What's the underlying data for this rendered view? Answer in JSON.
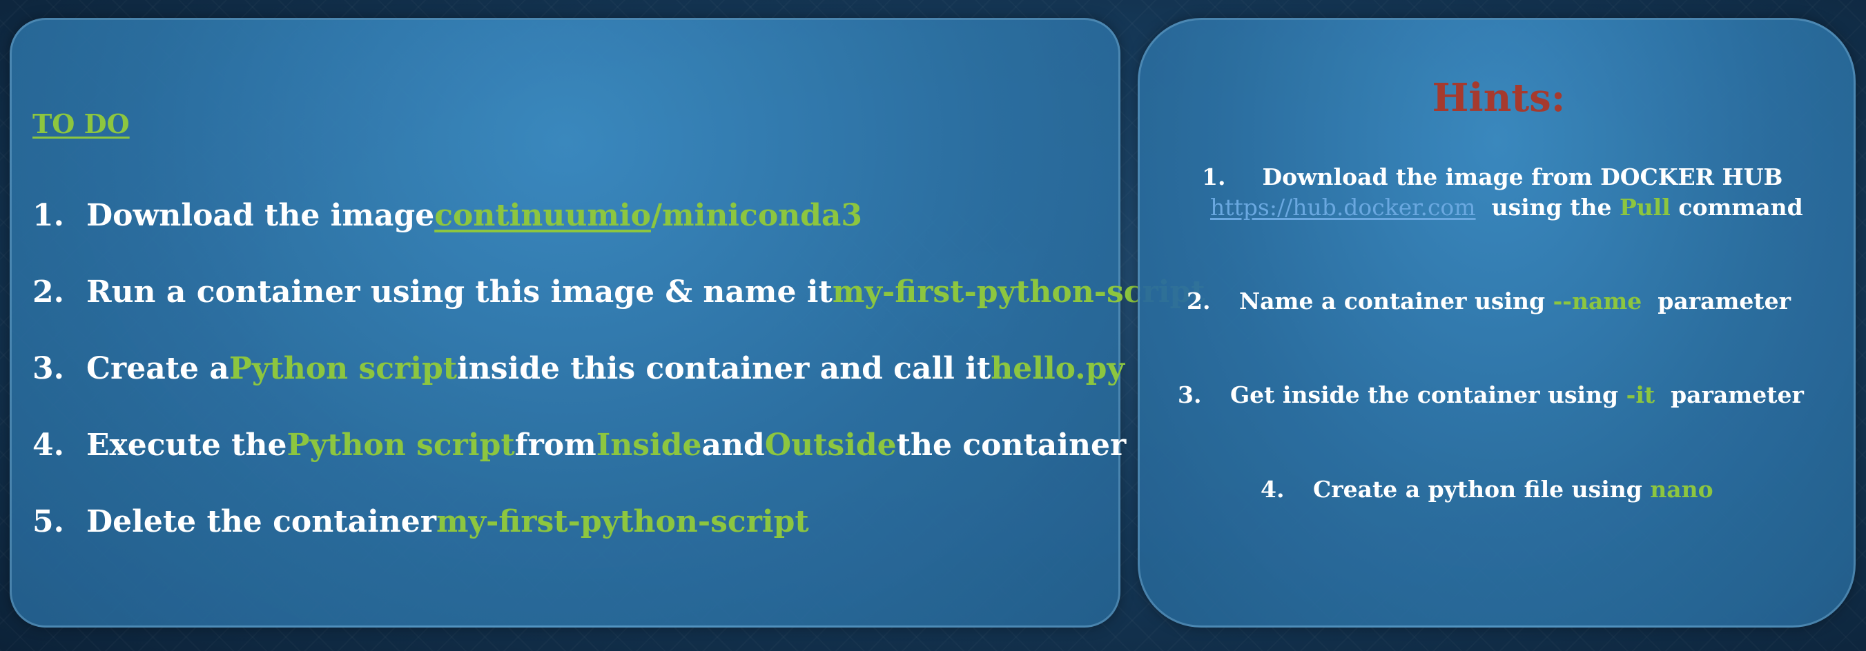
{
  "todo": {
    "title": "TO DO",
    "items": [
      {
        "number": "1.",
        "parts": [
          "Download the image ",
          "continuumio",
          "/",
          "miniconda3"
        ]
      },
      {
        "number": "2.",
        "parts": [
          "Run a container using this image & name it ",
          "my-first-python-script"
        ]
      },
      {
        "number": "3.",
        "parts": [
          "Create a ",
          "Python script",
          " inside this container and call it ",
          "hello.py"
        ]
      },
      {
        "number": "4.",
        "parts": [
          "Execute the ",
          "Python script",
          " from ",
          "Inside",
          " and ",
          "Outside",
          " the container"
        ]
      },
      {
        "number": "5.",
        "parts": [
          "Delete the container ",
          "my-first-python-script"
        ]
      }
    ]
  },
  "hints": {
    "title": "Hints:",
    "items": [
      {
        "number": "1.",
        "line1": "Download the image from DOCKER HUB",
        "link": "https://hub.docker.com",
        "line2_pre": "  using the ",
        "line2_hl": "Pull",
        "line2_post": " command"
      },
      {
        "number": "2.",
        "pre": "Name a container using ",
        "hl": "--name",
        "post": "  parameter"
      },
      {
        "number": "3.",
        "pre": "Get inside the container using ",
        "hl": "-it",
        "post": "  parameter"
      },
      {
        "number": "4.",
        "pre": "Create a python file using ",
        "hl": "nano",
        "post": ""
      }
    ]
  },
  "colors": {
    "accent_green": "#8dc63f",
    "hint_title_red": "#a63a2e",
    "link_blue": "#6aa8e0",
    "panel_blue": "#2f78ab"
  }
}
